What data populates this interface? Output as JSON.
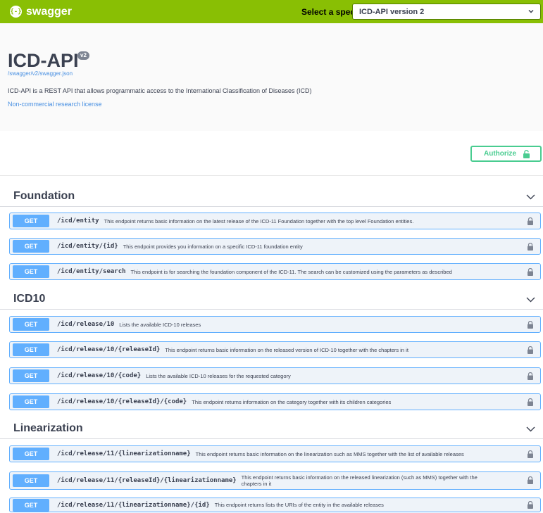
{
  "topbar": {
    "brand_icon": "{-}",
    "brand_name": "swagger",
    "spec_label": "Select a spec",
    "spec_selected": "ICD-API version 2",
    "color": "#89bf04"
  },
  "info": {
    "title": "ICD-API",
    "version": "v2",
    "spec_url": "/swagger/v2/swagger.json",
    "description": "ICD-API is a REST API that allows programmatic access to the International Classification of Diseases (ICD)",
    "license": "Non-commercial research license"
  },
  "authorize": {
    "label": "Authorize",
    "color": "#49cc90"
  },
  "method_color": "#61affe",
  "sections": [
    {
      "title": "Foundation",
      "operations": [
        {
          "method": "GET",
          "path": "/icd/entity",
          "summary": "This endpoint returns basic information on the latest release of the ICD-11 Foundation together with the top level Foundation entities."
        },
        {
          "method": "GET",
          "path": "/icd/entity/{id}",
          "summary": "This endpoint provides you information on a specific ICD-11 foundation entity"
        },
        {
          "method": "GET",
          "path": "/icd/entity/search",
          "summary": "This endpoint is for searching the foundation component of the ICD-11. The search can be customized using the parameters as described"
        }
      ]
    },
    {
      "title": "ICD10",
      "operations": [
        {
          "method": "GET",
          "path": "/icd/release/10",
          "summary": "Lists the available ICD-10 releases"
        },
        {
          "method": "GET",
          "path": "/icd/release/10/{releaseId}",
          "summary": "This endpoint returns basic information on the released version of ICD-10 together with the chapters in it"
        },
        {
          "method": "GET",
          "path": "/icd/release/10/{code}",
          "summary": "Lists the available ICD-10 releases for the requested category"
        },
        {
          "method": "GET",
          "path": "/icd/release/10/{releaseId}/{code}",
          "summary": "This endpoint returns information on the category together with its children categories"
        }
      ]
    },
    {
      "title": "Linearization",
      "operations": [
        {
          "method": "GET",
          "path": "/icd/release/11/{linearizationname}",
          "summary": "This endpoint returns basic information on the linearization such as MMS together with the list of available releases"
        },
        {
          "method": "GET",
          "path": "/icd/release/11/{releaseId}/{linearizationname}",
          "summary": "This endpoint returns basic information on the released linearization (such as MMS) together with the chapters in it"
        },
        {
          "method": "GET",
          "path": "/icd/release/11/{linearizationname}/{id}",
          "summary": "This endpoint returns lists the URIs of the entity in the available releases"
        }
      ]
    }
  ]
}
